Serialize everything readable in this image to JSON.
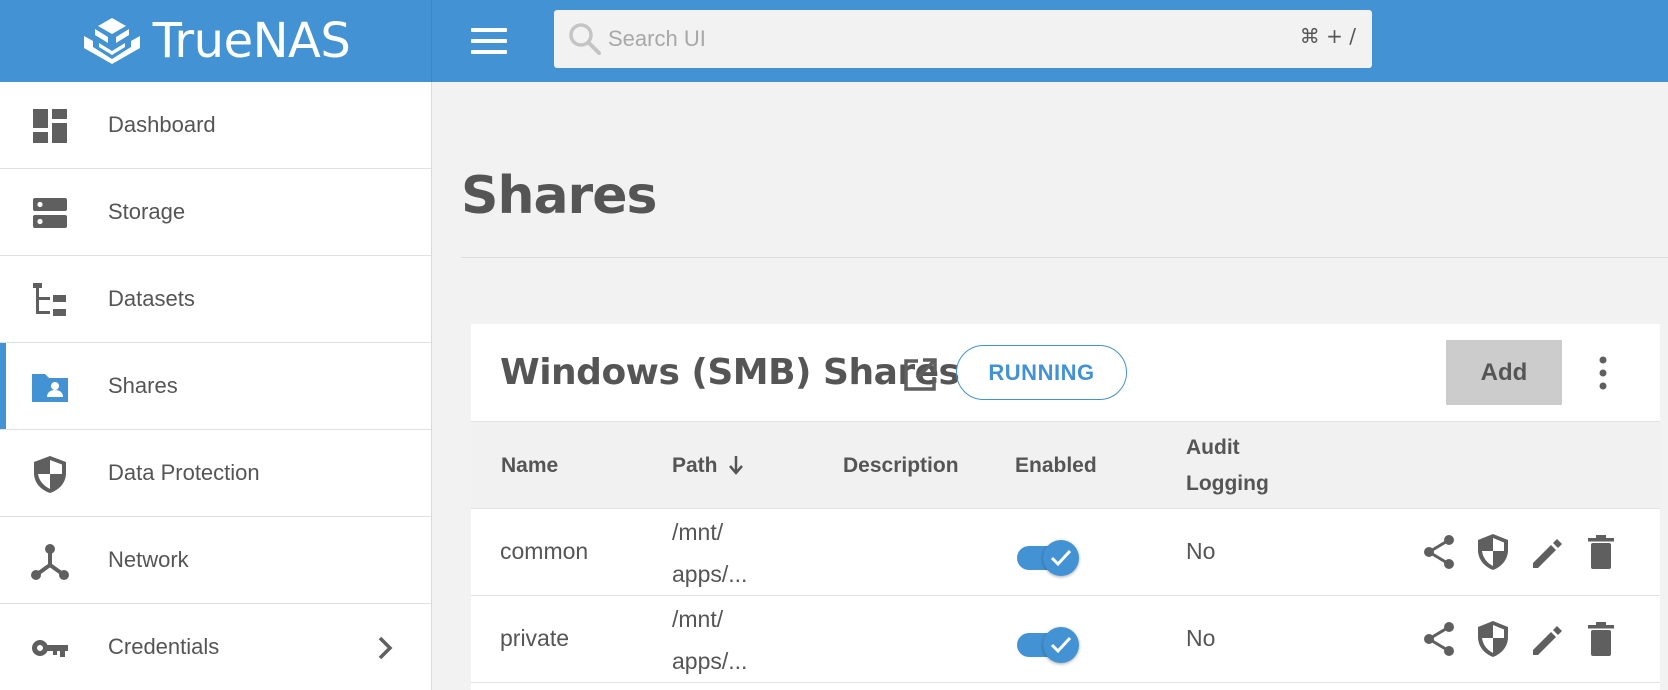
{
  "brand": {
    "name": "TrueNAS"
  },
  "search": {
    "placeholder": "Search UI",
    "shortcut": "⌘ + /"
  },
  "sidebar": {
    "items": [
      {
        "label": "Dashboard",
        "icon": "dashboard-icon"
      },
      {
        "label": "Storage",
        "icon": "storage-icon"
      },
      {
        "label": "Datasets",
        "icon": "datasets-icon"
      },
      {
        "label": "Shares",
        "icon": "shares-icon",
        "active": true
      },
      {
        "label": "Data Protection",
        "icon": "shield-icon"
      },
      {
        "label": "Network",
        "icon": "network-icon"
      },
      {
        "label": "Credentials",
        "icon": "key-icon",
        "expandable": true
      }
    ]
  },
  "page": {
    "title": "Shares"
  },
  "smb_card": {
    "title": "Windows (SMB) Shares",
    "status": "RUNNING",
    "add_label": "Add",
    "columns": {
      "name": "Name",
      "path": "Path",
      "description": "Description",
      "enabled": "Enabled",
      "audit_line1": "Audit",
      "audit_line2": "Logging"
    },
    "rows": [
      {
        "name": "common",
        "path_line1": "/mnt/",
        "path_line2": "apps/...",
        "description": "",
        "enabled": true,
        "audit": "No"
      },
      {
        "name": "private",
        "path_line1": "/mnt/",
        "path_line2": "apps/...",
        "description": "",
        "enabled": true,
        "audit": "No"
      }
    ]
  },
  "colors": {
    "accent": "#4393d4",
    "icon_gray": "#5f5f5f",
    "button_gray": "#cccccc"
  }
}
